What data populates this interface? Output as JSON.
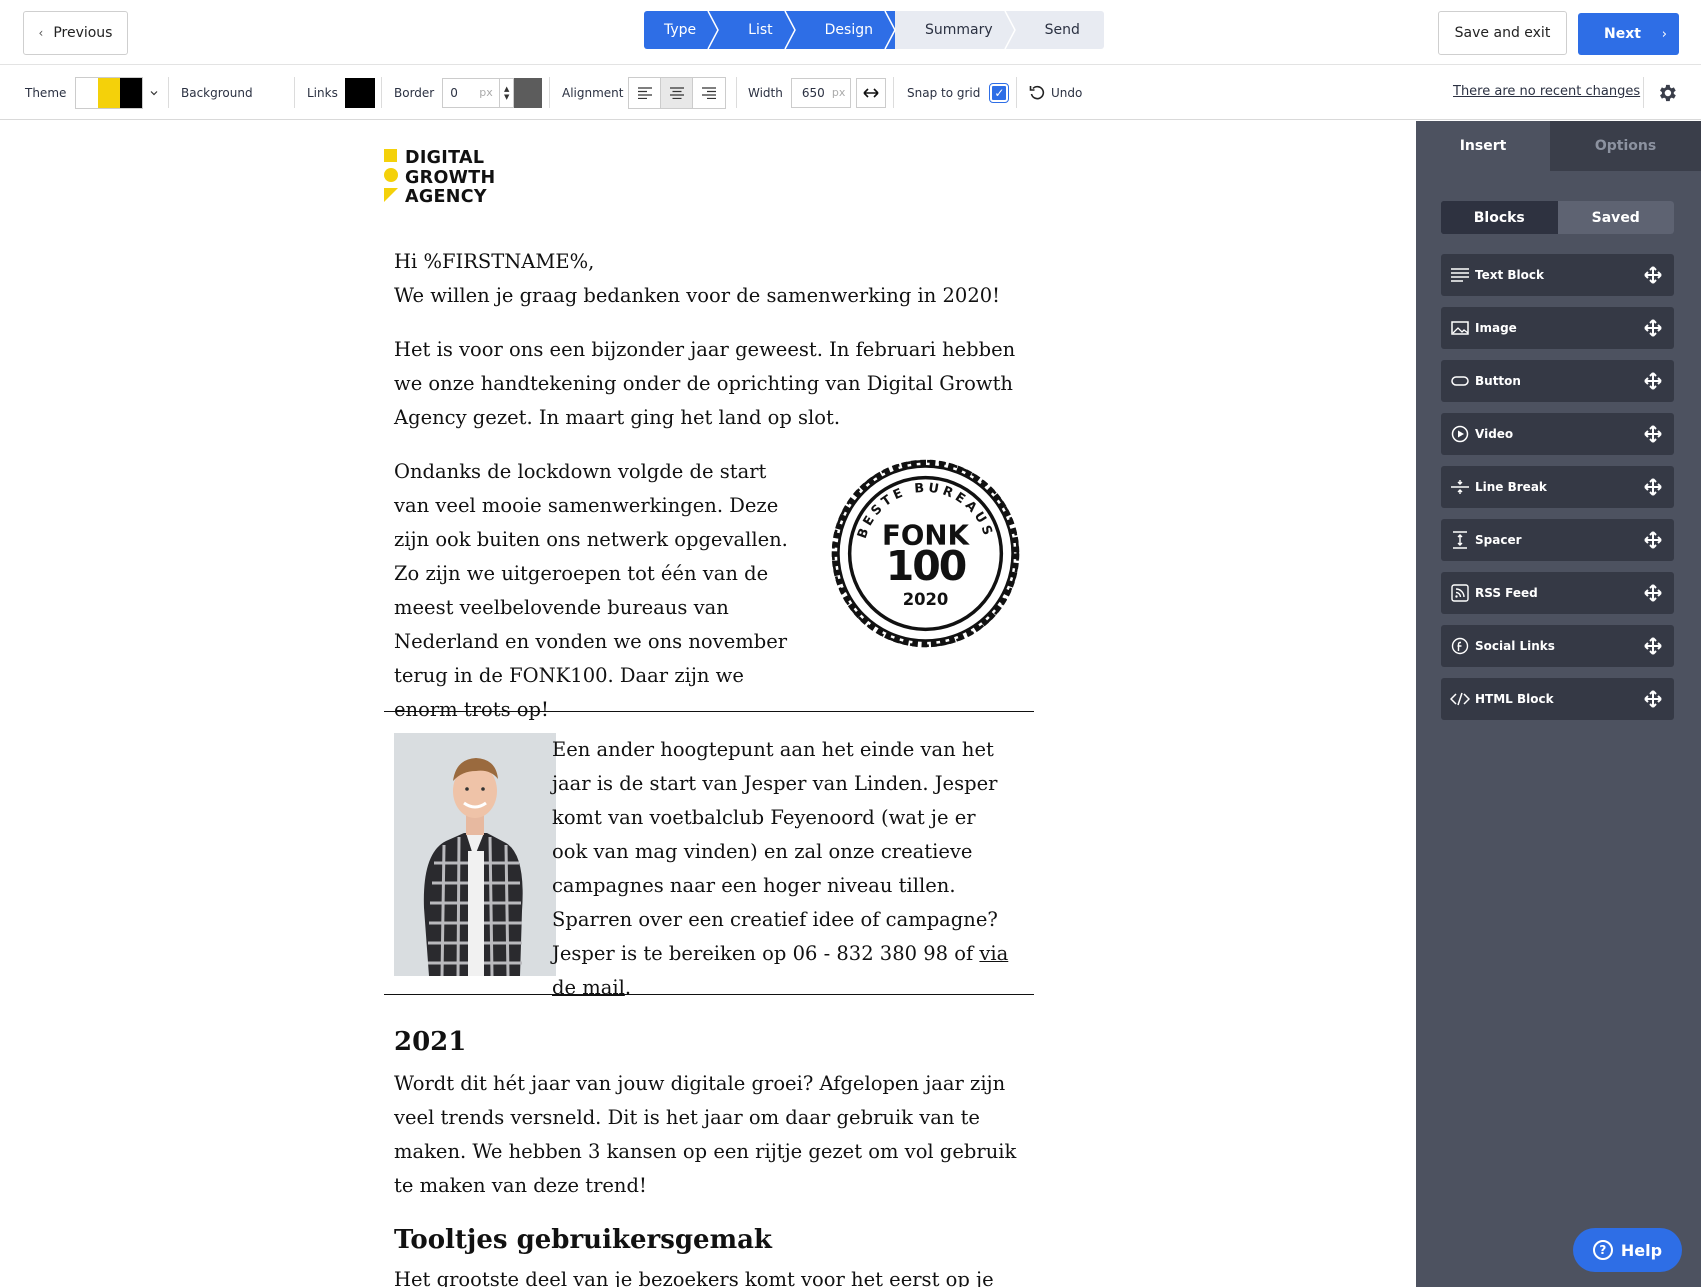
{
  "nav": {
    "previous_label": "Previous",
    "steps": [
      "Type",
      "List",
      "Design",
      "Summary",
      "Send"
    ],
    "save_exit_label": "Save and exit",
    "next_label": "Next"
  },
  "toolbar": {
    "theme_label": "Theme",
    "theme_colors": [
      "#ffffff",
      "#f4d10a",
      "#000000"
    ],
    "background_label": "Background",
    "links_label": "Links",
    "links_color": "#000000",
    "border_label": "Border",
    "border_value": "0",
    "border_unit": "px",
    "border_color": "#5c5c5c",
    "alignment_label": "Alignment",
    "alignment_selected": "center",
    "width_label": "Width",
    "width_value": "650",
    "width_unit": "px",
    "snap_label": "Snap to grid",
    "snap_checked": true,
    "undo_label": "Undo",
    "recent_changes": "There are no recent changes"
  },
  "email": {
    "logo_lines": [
      "DIGITAL",
      "GROWTH",
      "AGENCY"
    ],
    "greeting": "Hi %FIRSTNAME%,",
    "thanks": "We willen je graag bedanken voor de samenwerking in 2020!",
    "para1": "Het is voor ons een bijzonder jaar geweest. In februari hebben we onze handtekening onder de oprichting van Digital Growth Agency gezet. In maart ging het land op slot.",
    "para2": "Ondanks de lockdown volgde de start van veel mooie samenwerkingen. Deze zijn ook buiten ons netwerk opgevallen. Zo zijn we uitgeroepen tot één van de meest veelbelovende bureaus van Nederland en vonden we ons november terug in de FONK100. Daar zijn we enorm trots op!",
    "badge": {
      "arc": "BESTE BUREAUS",
      "line1": "FONK",
      "line2": "100",
      "year": "2020"
    },
    "para3": "Een ander hoogtepunt aan het einde van het jaar is de start van Jesper van Linden. Jesper komt van voetbalclub Feyenoord (wat je er ook van mag vinden) en zal onze creatieve campagnes naar een hoger niveau tillen. Sparren over een creatief idee of campagne? Jesper is te bereiken op 06 - 832 380 98 of ",
    "para3_link": "via de mail",
    "para3_end": ".",
    "heading_2021": "2021",
    "para4": "Wordt dit hét jaar van jouw digitale groei? Afgelopen jaar zijn veel trends versneld. Dit is het jaar om daar gebruik van te maken. We hebben 3 kansen op een rijtje gezet om vol gebruik te maken van deze trend!",
    "heading_tools": "Tooltjes gebruikersgemak",
    "para5": "Het grootste deel van je bezoekers komt voor het eerst op je"
  },
  "panel": {
    "tabs": [
      "Insert",
      "Options"
    ],
    "segments": [
      "Blocks",
      "Saved"
    ],
    "blocks": [
      {
        "label": "Text Block",
        "icon": "text-block-icon"
      },
      {
        "label": "Image",
        "icon": "image-icon"
      },
      {
        "label": "Button",
        "icon": "button-icon"
      },
      {
        "label": "Video",
        "icon": "video-icon"
      },
      {
        "label": "Line Break",
        "icon": "line-break-icon"
      },
      {
        "label": "Spacer",
        "icon": "spacer-icon"
      },
      {
        "label": "RSS Feed",
        "icon": "rss-icon"
      },
      {
        "label": "Social Links",
        "icon": "social-links-icon"
      },
      {
        "label": "HTML Block",
        "icon": "html-block-icon"
      }
    ]
  },
  "help_label": "Help",
  "colors": {
    "accent": "#2e6ee6",
    "panel": "#4d5260",
    "logo_yellow": "#f4d10a"
  }
}
